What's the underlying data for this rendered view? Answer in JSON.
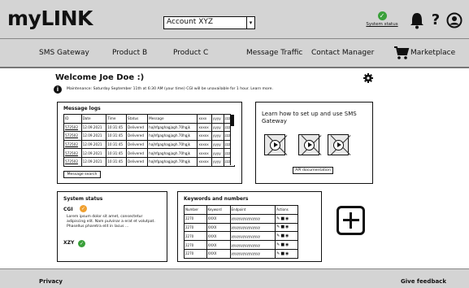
{
  "header": {
    "logo": "myLINK",
    "account_selected": "Account XYZ",
    "system_status_label": "System status"
  },
  "nav": {
    "items": [
      "SMS Gateway",
      "Product B",
      "Product C",
      "Message Traffic",
      "Contact Manager",
      "Marketplace"
    ]
  },
  "main": {
    "welcome": "Welcome Joe Doe :)",
    "maintenance": "Maintenance: Saturday September 11th at 6:30 AM (your time) CGI will be unavailable for 1 hour. Learn more.",
    "message_logs": {
      "title": "Message logs",
      "columns": [
        "ID",
        "Date",
        "Time",
        "Status",
        "Message",
        "xxxx",
        "yyyy",
        "zzzz"
      ],
      "rows": [
        [
          "572502",
          "12.09.2021",
          "10:31:45",
          "Delivered",
          "hajhfgaghagjagh.70hgjk",
          "xxxxx",
          "yyyy",
          "zzzz"
        ],
        [
          "572502",
          "12.09.2021",
          "10:31:45",
          "Delivered",
          "hajhfgaghagjagh.70hgjk",
          "xxxxx",
          "yyyy",
          "zzzz"
        ],
        [
          "572502",
          "12.09.2021",
          "10:31:45",
          "Delivered",
          "hajhfgaghagjagh.70hgjk",
          "xxxxx",
          "yyyy",
          "zzzz"
        ],
        [
          "572502",
          "12.09.2021",
          "10:31:45",
          "Delivered",
          "hajhfgaghagjagh.70hgjk",
          "xxxxx",
          "yyyy",
          "zzzz"
        ],
        [
          "572502",
          "12.09.2021",
          "10:31:45",
          "Delivered",
          "hajhfgaghagjagh.70hgjk",
          "xxxxx",
          "yyyy",
          "zzzz"
        ]
      ],
      "search_button": "Message search"
    },
    "learn": {
      "title": "Learn how to set up and use SMS Gateway",
      "api_button": "API documentation"
    },
    "system_status": {
      "title": "System status",
      "items": [
        {
          "name": "CGI",
          "status_color": "#f0a030",
          "description": "Lorem ipsum dolor sit amet, consectetur adipiscing elit. Nam pulvinar a erat et volutpat. Phasellus pharetra elit in lacus ..."
        },
        {
          "name": "XZY",
          "status_color": "#3aa03a",
          "description": ""
        }
      ]
    },
    "keywords": {
      "title": "Keywords and numbers",
      "columns": [
        "Number",
        "Keyword",
        "Endpoint",
        "Actions"
      ],
      "rows": [
        [
          "2270",
          "XXXX",
          "yyyyyyyyyyyyyyy"
        ],
        [
          "2270",
          "XXXX",
          "yyyyyyyyyyyyyyy"
        ],
        [
          "2270",
          "XXXX",
          "yyyyyyyyyyyyyyy"
        ],
        [
          "2270",
          "XXXX",
          "yyyyyyyyyyyyyyy"
        ],
        [
          "2270",
          "XXXX",
          "yyyyyyyyyyyyyyy"
        ]
      ],
      "action_icons": [
        "edit-icon",
        "delete-icon",
        "view-icon"
      ]
    }
  },
  "footer": {
    "privacy": "Privacy",
    "feedback": "Give feedback"
  },
  "colors": {
    "bar_gray": "#d4d4d4",
    "ok_green": "#3aa03a",
    "warn_orange": "#f0a030"
  }
}
